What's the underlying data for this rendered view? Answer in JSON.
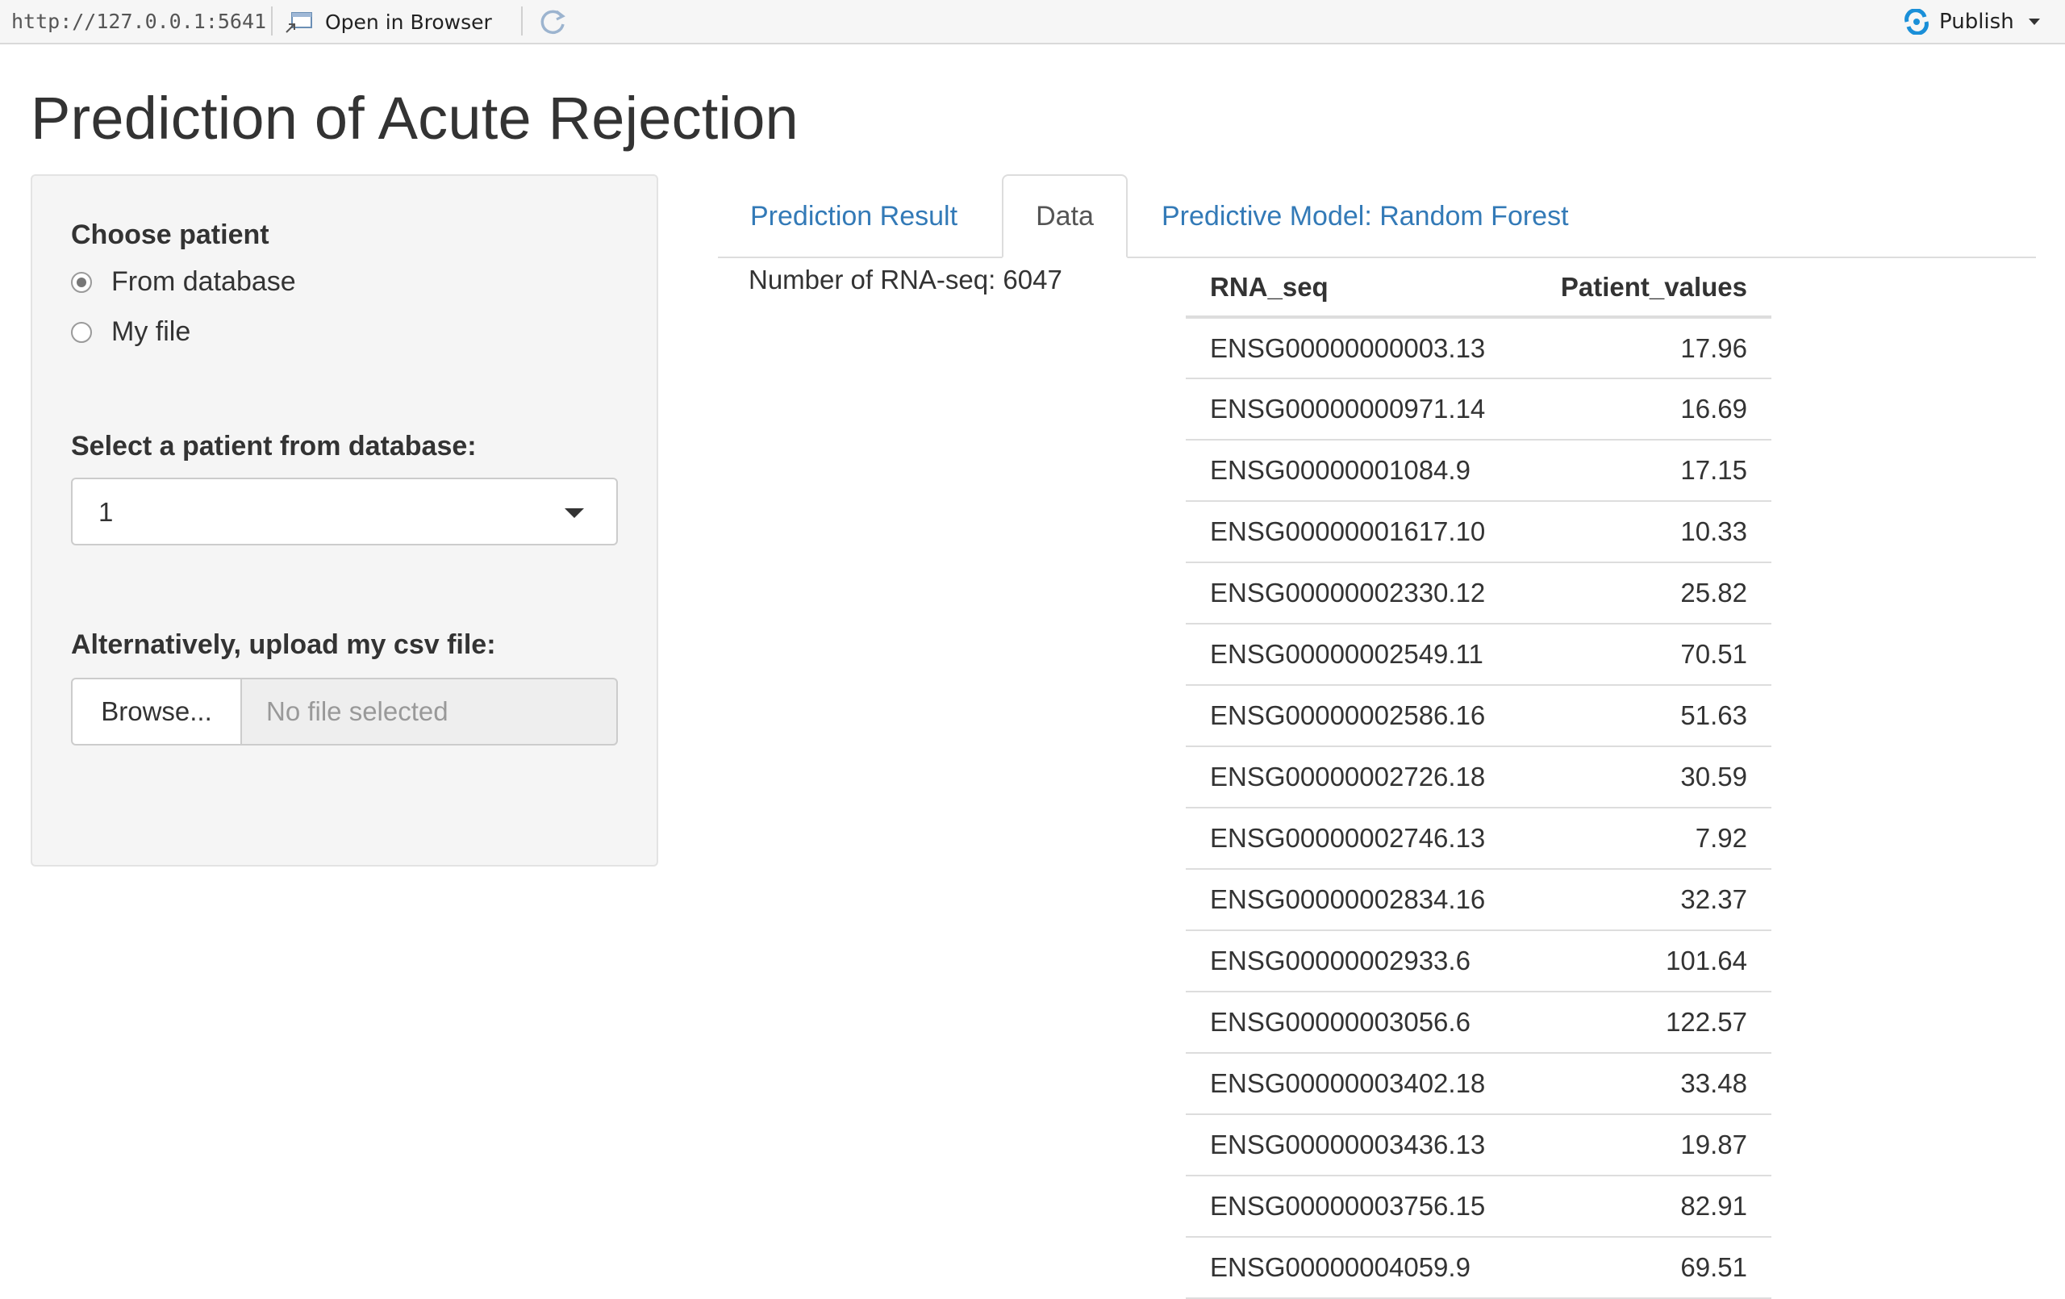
{
  "toolbar": {
    "url": "http://127.0.0.1:5641",
    "open_in_browser": "Open in Browser",
    "publish": "Publish"
  },
  "page": {
    "title": "Prediction of Acute Rejection"
  },
  "sidebar": {
    "choose_patient_label": "Choose patient",
    "radio_options": [
      {
        "label": "From database",
        "checked": true
      },
      {
        "label": "My file",
        "checked": false
      }
    ],
    "select_label": "Select a patient from database:",
    "select_value": "1",
    "upload_label": "Alternatively, upload my csv file:",
    "browse_label": "Browse...",
    "file_placeholder": "No file selected"
  },
  "tabs": [
    {
      "label": "Prediction Result",
      "active": false
    },
    {
      "label": "Data",
      "active": true
    },
    {
      "label": "Predictive Model: Random Forest",
      "active": false
    }
  ],
  "data_panel": {
    "count_text": "Number of RNA-seq: 6047",
    "columns": [
      "RNA_seq",
      "Patient_values"
    ],
    "rows": [
      [
        "ENSG00000000003.13",
        "17.96"
      ],
      [
        "ENSG00000000971.14",
        "16.69"
      ],
      [
        "ENSG00000001084.9",
        "17.15"
      ],
      [
        "ENSG00000001617.10",
        "10.33"
      ],
      [
        "ENSG00000002330.12",
        "25.82"
      ],
      [
        "ENSG00000002549.11",
        "70.51"
      ],
      [
        "ENSG00000002586.16",
        "51.63"
      ],
      [
        "ENSG00000002726.18",
        "30.59"
      ],
      [
        "ENSG00000002746.13",
        "7.92"
      ],
      [
        "ENSG00000002834.16",
        "32.37"
      ],
      [
        "ENSG00000002933.6",
        "101.64"
      ],
      [
        "ENSG00000003056.6",
        "122.57"
      ],
      [
        "ENSG00000003402.18",
        "33.48"
      ],
      [
        "ENSG00000003436.13",
        "19.87"
      ],
      [
        "ENSG00000003756.15",
        "82.91"
      ],
      [
        "ENSG00000004059.9",
        "69.51"
      ]
    ]
  },
  "colors": {
    "link": "#337ab7",
    "publish_icon": "#1a8fd8"
  }
}
